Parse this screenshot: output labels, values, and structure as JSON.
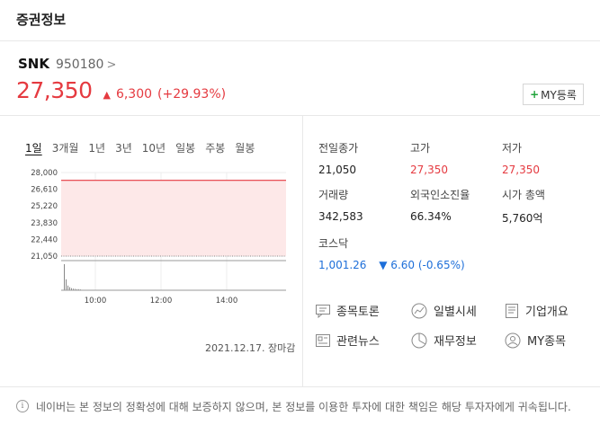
{
  "header": {
    "title": "증권정보"
  },
  "stock": {
    "name": "SNK",
    "code": "950180",
    "chevron": ">",
    "price": "27,350",
    "change": "6,300",
    "change_pct": "(+29.93%)",
    "up_color": "#e53a40",
    "my_button": "MY등록"
  },
  "period_tabs": [
    "1일",
    "3개월",
    "1년",
    "3년",
    "10년",
    "일봉",
    "주봉",
    "월봉"
  ],
  "active_period": "1일",
  "chart_data": {
    "type": "area",
    "title": "",
    "xlabel": "",
    "ylabel": "",
    "y_ticks": [
      "28,000",
      "26,610",
      "25,220",
      "23,830",
      "22,440",
      "21,050"
    ],
    "x_ticks": [
      "10:00",
      "12:00",
      "14:00"
    ],
    "ylim": [
      21050,
      28000
    ],
    "price_line": 27350,
    "base_line": 21050,
    "fill_color": "#fde8e8",
    "line_color": "#e53a40",
    "volume": [
      1.0,
      0.42,
      0.18,
      0.12,
      0.08,
      0.06,
      0.05,
      0.04,
      0.04,
      0.03
    ]
  },
  "chart_date": "2021.12.17. 장마감",
  "stats": {
    "prev_close": {
      "label": "전일종가",
      "value": "21,050"
    },
    "high": {
      "label": "고가",
      "value": "27,350"
    },
    "low": {
      "label": "저가",
      "value": "27,350"
    },
    "volume": {
      "label": "거래량",
      "value": "342,583"
    },
    "foreign": {
      "label": "외국인소진율",
      "value": "66.34%"
    },
    "mcap": {
      "label": "시가 총액",
      "value": "5,760억"
    },
    "kosdaq": {
      "label": "코스닥",
      "value": "1,001.26",
      "change": "▼ 6.60 (-0.65%)"
    }
  },
  "links": {
    "discussion": "종목토론",
    "daily": "일별시세",
    "company": "기업개요",
    "news": "관련뉴스",
    "finance": "재무정보",
    "my_stock": "MY종목"
  },
  "footer": {
    "notice": "네이버는 본 정보의 정확성에 대해 보증하지 않으며, 본 정보를 이용한 투자에 대한 책임은 해당 투자자에게 귀속됩니다."
  }
}
